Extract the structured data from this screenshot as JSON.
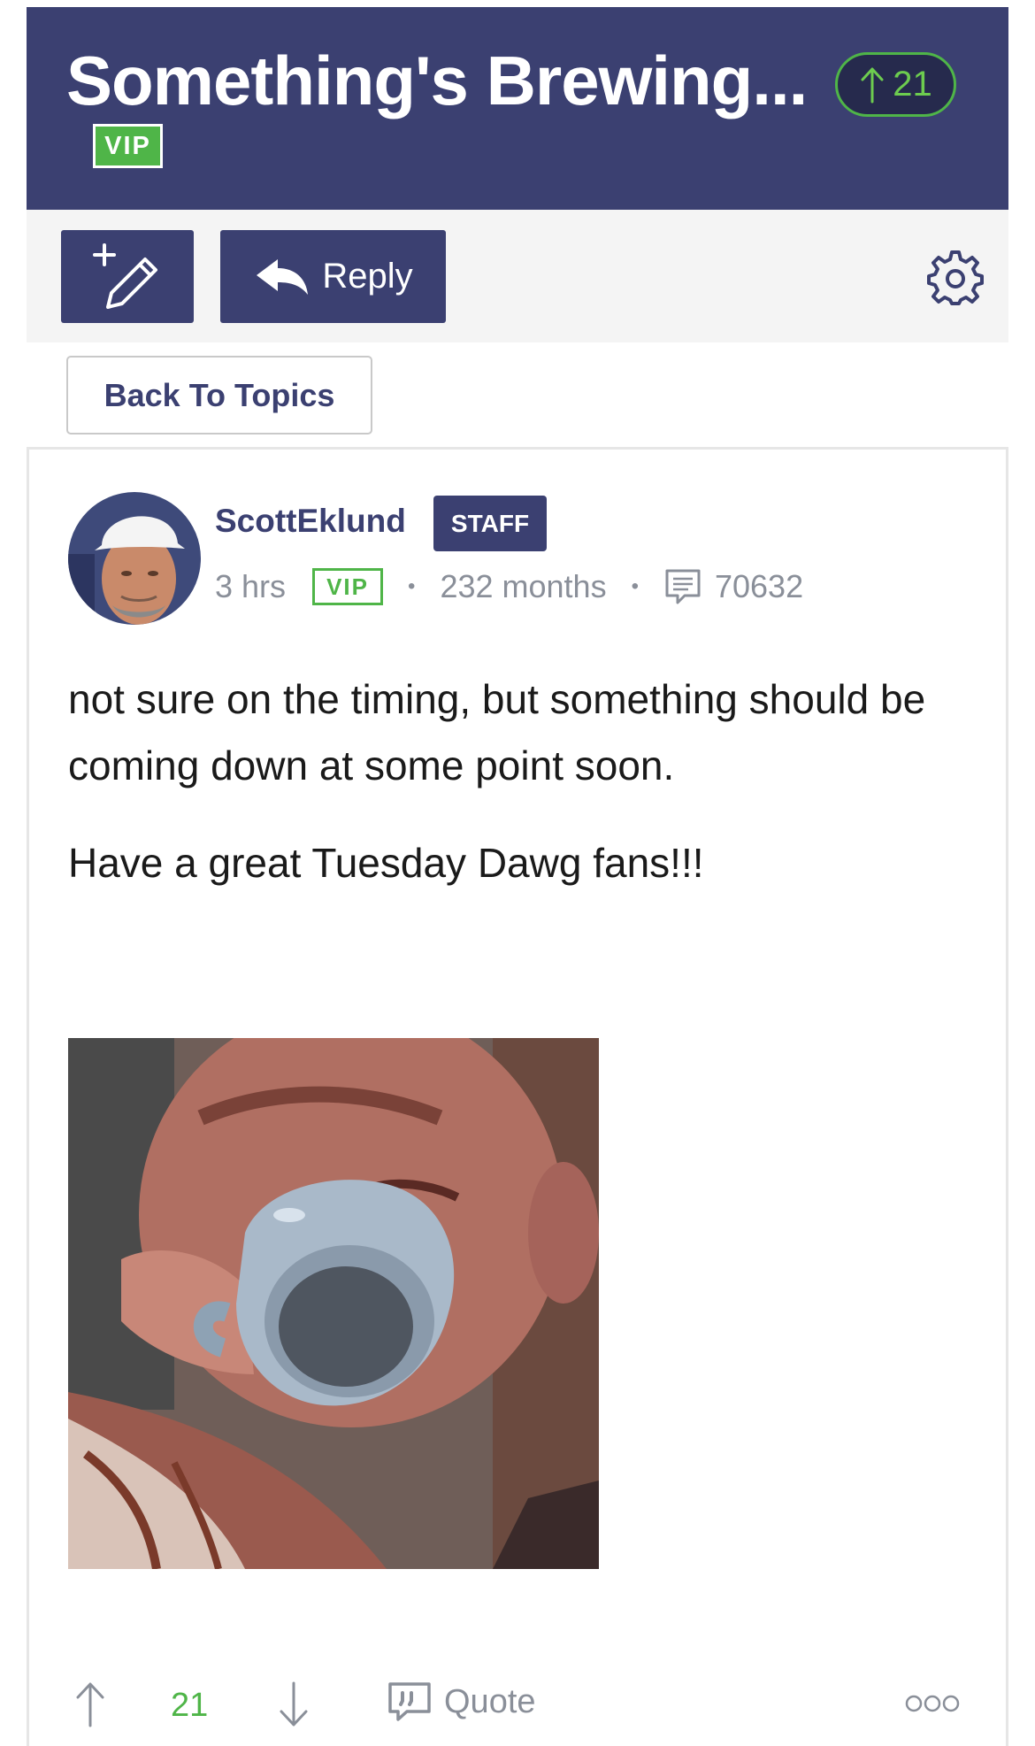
{
  "header": {
    "title": "Something's Brewing...",
    "vote_count": "21",
    "badge": "VIP"
  },
  "toolbar": {
    "new_topic_icon": "new-post-pencil-icon",
    "reply_label": "Reply",
    "settings_icon": "gear-icon"
  },
  "navigation": {
    "back_label": "Back To Topics"
  },
  "post": {
    "author": "ScottEklund",
    "role_badge": "STAFF",
    "time": "3 hrs",
    "member_badge": "VIP",
    "membership": "232 months",
    "post_count": "70632",
    "paragraphs": [
      "not sure on the timing, but something should be coming down at some point soon.",
      "Have a great Tuesday Dawg fans!!!"
    ],
    "image_description_icon": "coffee-mug-gif"
  },
  "actions": {
    "vote_count": "21",
    "quote_label": "Quote",
    "more_icon": "more-options-icon"
  },
  "colors": {
    "brand": "#3b4071",
    "accent_green": "#4fb548",
    "muted": "#8a8f99"
  }
}
